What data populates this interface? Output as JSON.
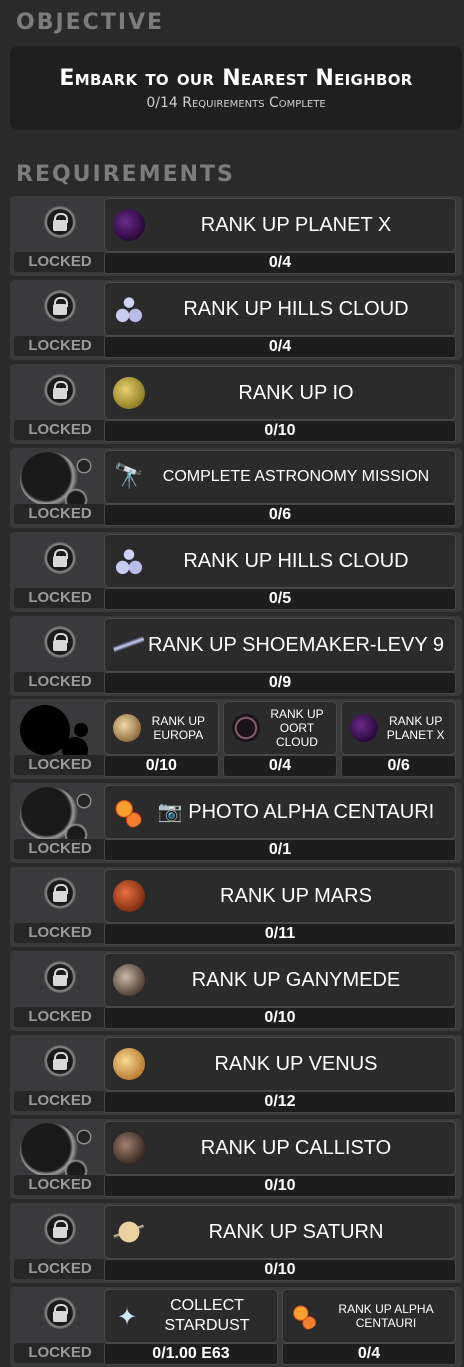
{
  "objective": {
    "header": "OBJECTIVE",
    "title": "Embark to our Nearest Neighbor",
    "progress": "0/14 Requirements Complete"
  },
  "requirements": {
    "header": "REQUIREMENTS",
    "locked_label": "LOCKED",
    "rows": [
      {
        "lock": "small",
        "cards": [
          {
            "icon": "planet-x-icon",
            "label": "RANK UP PLANET X",
            "progress": "0/4"
          }
        ]
      },
      {
        "lock": "small",
        "cards": [
          {
            "icon": "hills-cloud-icon",
            "label": "RANK UP HILLS CLOUD",
            "progress": "0/4"
          }
        ]
      },
      {
        "lock": "small",
        "cards": [
          {
            "icon": "io-icon",
            "label": "RANK UP IO",
            "progress": "0/10"
          }
        ]
      },
      {
        "lock": "big",
        "cards": [
          {
            "icon": "telescope-icon",
            "label": "COMPLETE   ASTRONOMY MISSION",
            "progress": "0/6"
          }
        ]
      },
      {
        "lock": "small",
        "cards": [
          {
            "icon": "hills-cloud-icon",
            "label": "RANK UP HILLS CLOUD",
            "progress": "0/5"
          }
        ]
      },
      {
        "lock": "small",
        "cards": [
          {
            "icon": "comet-icon",
            "label": "RANK UP SHOEMAKER-LEVY 9",
            "progress": "0/9"
          }
        ]
      },
      {
        "lock": "dark",
        "cards": [
          {
            "icon": "europa-icon",
            "label": "RANK UP EUROPA",
            "progress": "0/10"
          },
          {
            "icon": "oort-cloud-icon",
            "label": "RANK UP OORT CLOUD",
            "progress": "0/4"
          },
          {
            "icon": "planet-x-icon",
            "label": "RANK UP PLANET X",
            "progress": "0/6"
          }
        ]
      },
      {
        "lock": "big",
        "cards": [
          {
            "icon": "alpha-centauri-icon",
            "label": "📷 PHOTO ALPHA CENTAURI",
            "progress": "0/1"
          }
        ]
      },
      {
        "lock": "small",
        "cards": [
          {
            "icon": "mars-icon",
            "label": "RANK UP MARS",
            "progress": "0/11"
          }
        ]
      },
      {
        "lock": "small",
        "cards": [
          {
            "icon": "ganymede-icon",
            "label": "RANK UP GANYMEDE",
            "progress": "0/10"
          }
        ]
      },
      {
        "lock": "small",
        "cards": [
          {
            "icon": "venus-icon",
            "label": "RANK UP VENUS",
            "progress": "0/12"
          }
        ]
      },
      {
        "lock": "big",
        "cards": [
          {
            "icon": "callisto-icon",
            "label": "RANK UP CALLISTO",
            "progress": "0/10"
          }
        ]
      },
      {
        "lock": "small",
        "cards": [
          {
            "icon": "saturn-icon",
            "label": "RANK UP SATURN",
            "progress": "0/10"
          }
        ]
      },
      {
        "lock": "small",
        "cards": [
          {
            "icon": "stardust-icon",
            "label": "COLLECT STARDUST",
            "progress": "0/1.00 E63"
          },
          {
            "icon": "alpha-centauri-icon",
            "label": "RANK UP ALPHA CENTAURI",
            "progress": "0/4"
          }
        ]
      }
    ]
  },
  "colors": {
    "background": "#2a2a2b",
    "header_text": "#7c7c7c",
    "row_bg": "#3a3a3c",
    "locked_text": "#9a9a9a"
  }
}
